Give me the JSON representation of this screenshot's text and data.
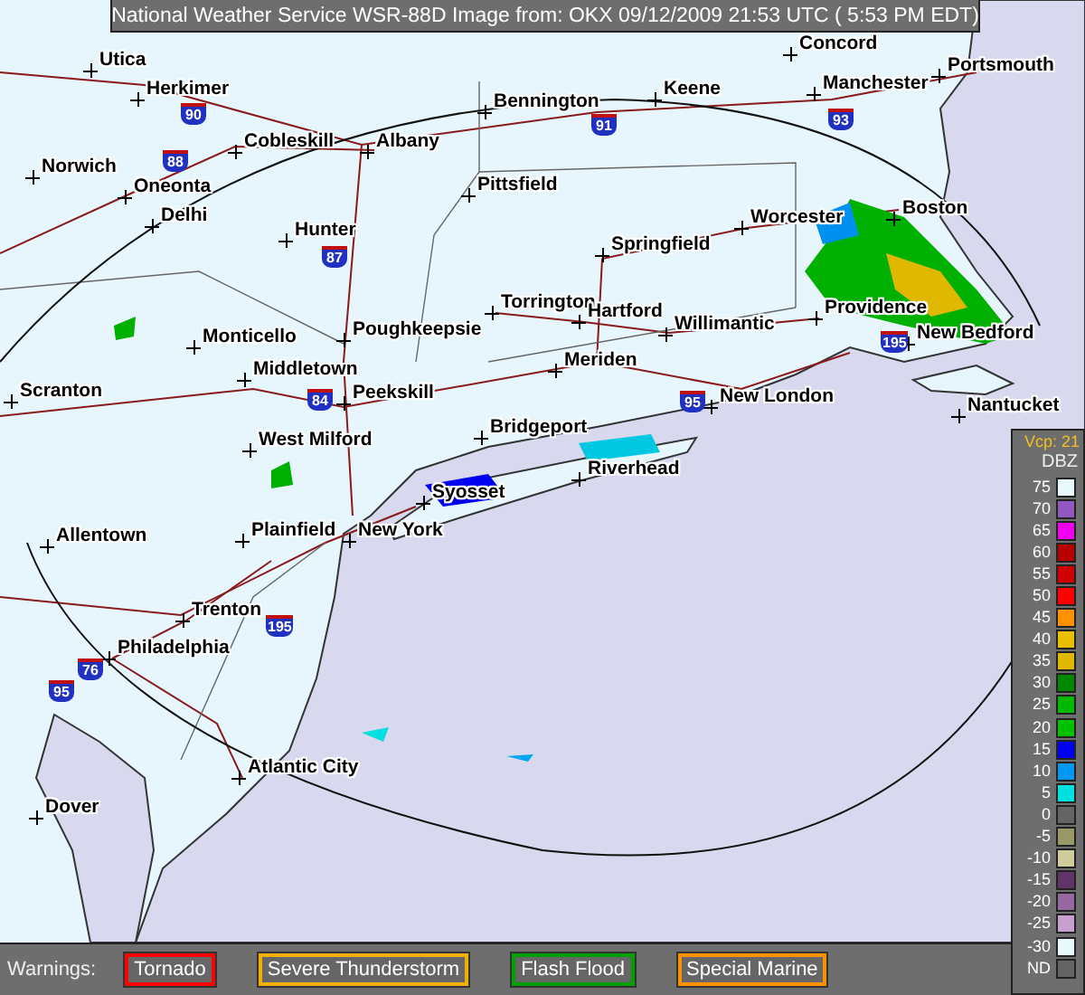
{
  "header": {
    "title": "National Weather Service WSR-88D Image from: OKX 09/12/2009 21:53 UTC ( 5:53 PM EDT)"
  },
  "map": {
    "cities": [
      {
        "name": "Concord"
      },
      {
        "name": "Utica"
      },
      {
        "name": "Portsmouth"
      },
      {
        "name": "Herkimer"
      },
      {
        "name": "Keene"
      },
      {
        "name": "Manchester"
      },
      {
        "name": "Bennington"
      },
      {
        "name": "Cobleskill"
      },
      {
        "name": "Albany"
      },
      {
        "name": "Norwich"
      },
      {
        "name": "Oneonta"
      },
      {
        "name": "Pittsfield"
      },
      {
        "name": "Delhi"
      },
      {
        "name": "Worcester"
      },
      {
        "name": "Boston"
      },
      {
        "name": "Hunter"
      },
      {
        "name": "Springfield"
      },
      {
        "name": "Monticello"
      },
      {
        "name": "Poughkeepsie"
      },
      {
        "name": "Torrington"
      },
      {
        "name": "Hartford"
      },
      {
        "name": "Willimantic"
      },
      {
        "name": "Providence"
      },
      {
        "name": "New Bedford"
      },
      {
        "name": "Middletown"
      },
      {
        "name": "Meriden"
      },
      {
        "name": "Scranton"
      },
      {
        "name": "Peekskill"
      },
      {
        "name": "New London"
      },
      {
        "name": "Nantucket"
      },
      {
        "name": "West Milford"
      },
      {
        "name": "Bridgeport"
      },
      {
        "name": "Riverhead"
      },
      {
        "name": "Syosset"
      },
      {
        "name": "Allentown"
      },
      {
        "name": "Plainfield"
      },
      {
        "name": "New York"
      },
      {
        "name": "Trenton"
      },
      {
        "name": "Philadelphia"
      },
      {
        "name": "Atlantic City"
      },
      {
        "name": "Dover"
      }
    ],
    "shields": [
      {
        "label": "90"
      },
      {
        "label": "88"
      },
      {
        "label": "87"
      },
      {
        "label": "91"
      },
      {
        "label": "93"
      },
      {
        "label": "84"
      },
      {
        "label": "95"
      },
      {
        "label": "195"
      },
      {
        "label": "195"
      },
      {
        "label": "76"
      },
      {
        "label": "95"
      }
    ]
  },
  "legend": {
    "mode": "Vcp: 21",
    "unit": "DBZ",
    "levels": [
      {
        "label": "75",
        "color": "#e8f8fc"
      },
      {
        "label": "70",
        "color": "#9058c0"
      },
      {
        "label": "65",
        "color": "#f000f0"
      },
      {
        "label": "60",
        "color": "#b80000"
      },
      {
        "label": "55",
        "color": "#d00000"
      },
      {
        "label": "50",
        "color": "#ff0000"
      },
      {
        "label": "45",
        "color": "#ff9000"
      },
      {
        "label": "40",
        "color": "#e8c000"
      },
      {
        "label": "35",
        "color": "#e0b800"
      },
      {
        "label": "30",
        "color": "#008800"
      },
      {
        "label": "25",
        "color": "#00b800"
      },
      {
        "label": "20",
        "color": "#00c000"
      },
      {
        "label": "15",
        "color": "#0000f0"
      },
      {
        "label": "10",
        "color": "#0098f0"
      },
      {
        "label": "5",
        "color": "#00e0e0"
      },
      {
        "label": "0",
        "color": "#646464"
      },
      {
        "label": "-5",
        "color": "#989868"
      },
      {
        "label": "-10",
        "color": "#d0cc9c"
      },
      {
        "label": "-15",
        "color": "#603468"
      },
      {
        "label": "-20",
        "color": "#9868a0"
      },
      {
        "label": "-25",
        "color": "#c8a0d0"
      },
      {
        "label": "-30",
        "color": "#e8f8fc"
      },
      {
        "label": "ND",
        "color": "#646464"
      }
    ]
  },
  "warnings": {
    "label": "Warnings:",
    "items": [
      {
        "label": "Tornado",
        "color": "#ff0000"
      },
      {
        "label": "Severe Thunderstorm",
        "color": "#f0b000"
      },
      {
        "label": "Flash Flood",
        "color": "#00a000"
      },
      {
        "label": "Special Marine",
        "color": "#ff9000"
      }
    ]
  }
}
